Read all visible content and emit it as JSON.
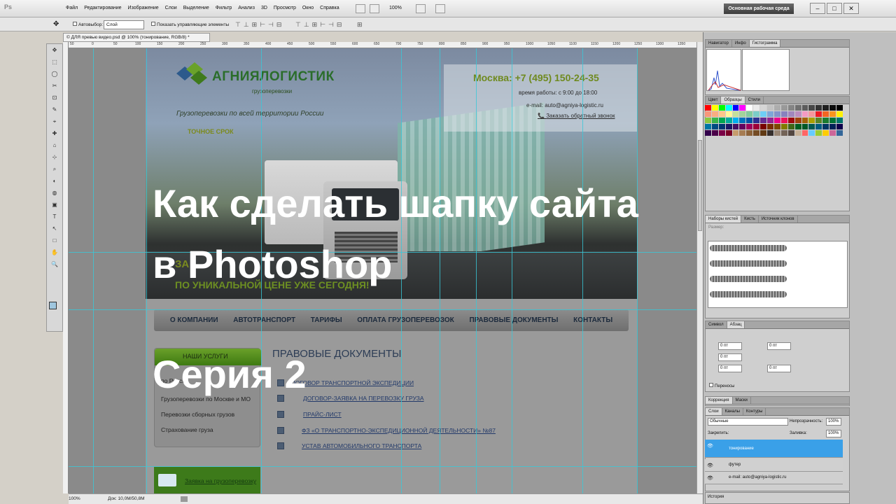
{
  "app": {
    "logo": "Ps",
    "workspace": "Основная рабочая среда",
    "zoom": "100%"
  },
  "menu": [
    "Файл",
    "Редактирование",
    "Изображение",
    "Слои",
    "Выделение",
    "Фильтр",
    "Анализ",
    "3D",
    "Просмотр",
    "Окно",
    "Справка"
  ],
  "options": {
    "autoselect": "Автовыбор:",
    "layer_value": "Слой",
    "show_controls": "Показать управляющие элементы"
  },
  "doc_tab": "© ДЛЯ превью видео.psd @ 100% (тонирование, RGB/8) *",
  "ruler_marks": [
    "50",
    "0",
    "50",
    "100",
    "150",
    "200",
    "250",
    "300",
    "350",
    "400",
    "450",
    "500",
    "550",
    "600",
    "650",
    "700",
    "750",
    "800",
    "850",
    "900",
    "950",
    "1000",
    "1050",
    "1100",
    "1150",
    "1200",
    "1250",
    "1300",
    "1350",
    "1400"
  ],
  "site": {
    "logo_text": "АГНИЯЛОГИСТИК",
    "logo_sub": "грузоперевозки",
    "tagline": "Грузоперевозки по всей территории России",
    "exact": "ТОЧНОЕ СРОК",
    "phone": "Москва: +7 (495) 150-24-35",
    "hours": "время работы: с 9:00 до 18:00",
    "email": "e-mail: auto@agniya-logistic.ru",
    "callback": "Заказать обратный звонок",
    "slogan1": "ЗА",
    "slogan2": "ПО УНИКАЛЬНОЙ ЦЕНЕ УЖЕ СЕГОДНЯ!",
    "nav": [
      "О КОМПАНИИ",
      "АВТОТРАНСПОРТ",
      "ТАРИФЫ",
      "ОПЛАТА ГРУЗОПЕРЕВОЗОК",
      "ПРАВОВЫЕ ДОКУМЕНТЫ",
      "КОНТАКТЫ"
    ],
    "services_title": "НАШИ УСЛУГИ",
    "services": [
      "по России",
      "Грузоперевозки по Москве и МО",
      "Перевозки сборных грузов",
      "Страхование груза"
    ],
    "docs_title": "ПРАВОВЫЕ ДОКУМЕНТЫ",
    "docs": [
      "ДОГОВОР ТРАНСПОРТНОЙ ЭКСПЕДИЦИИ",
      "ДОГОВОР-ЗАЯВКА НА ПЕРЕВОЗКУ ГРУЗА",
      "ПРАЙС-ЛИСТ",
      "ФЗ «О ТРАНСПОРТНО-ЭКСПЕДИЦИОННОЙ ДЕЯТЕЛЬНОСТИ» №87",
      "УСТАВ АВТОМОБИЛЬНОГО ТРАНСПОРТА"
    ],
    "app_link": "Заявка на грузоперевозку"
  },
  "overlay": {
    "line1": "Как сделать шапку сайта",
    "line2": "в Photoshop",
    "series": "Серия 2"
  },
  "status": {
    "zoom": "100%",
    "doc": "Док: 10,0M/50,8M"
  },
  "panels": {
    "nav_tabs": [
      "Навигатор",
      "Инфо",
      "Гистограмма"
    ],
    "color_tabs": [
      "Цвет",
      "Образцы",
      "Стили"
    ],
    "brush_tabs": [
      "Наборы кистей",
      "Кисть",
      "Источник клонов"
    ],
    "brush_size": "Размер:",
    "type_tabs": [
      "Символ",
      "Абзац"
    ],
    "para_values": [
      "0 пт",
      "0 пт",
      "0 пт",
      "0 пт",
      "0 пт"
    ],
    "hyphen": "Переносы",
    "adj_tabs": [
      "Коррекция",
      "Маски"
    ],
    "layer_tabs": [
      "Слои",
      "Каналы",
      "Контуры"
    ],
    "blend": "Обычные",
    "opacity_label": "Непрозрачность:",
    "opacity": "100%",
    "lock": "Закрепить:",
    "fill_label": "Заливка:",
    "fill": "100%",
    "layers": [
      "тонирование",
      "футер",
      "e-mail: auto@agniya-logistic.ru"
    ],
    "history": "История"
  },
  "swatch_colors": [
    "#ff0000",
    "#ffff00",
    "#00ff00",
    "#00ffff",
    "#0000ff",
    "#ff00ff",
    "#ffffff",
    "#ebebeb",
    "#d6d6d6",
    "#c2c2c2",
    "#adadad",
    "#999999",
    "#858585",
    "#707070",
    "#5c5c5c",
    "#474747",
    "#333333",
    "#1f1f1f",
    "#0a0a0a",
    "#000000",
    "#f7977a",
    "#f9ad81",
    "#fdc68a",
    "#fff79a",
    "#c4df9b",
    "#a2d39c",
    "#82ca9d",
    "#7bcdc8",
    "#6ecff6",
    "#7ea7d8",
    "#8493ca",
    "#8882be",
    "#a187be",
    "#bc8dbf",
    "#f49ac2",
    "#f6989d",
    "#ed1c24",
    "#f26522",
    "#f7941d",
    "#fff200",
    "#8dc73f",
    "#39b54a",
    "#00a651",
    "#00a99d",
    "#00aeef",
    "#0072bc",
    "#0054a6",
    "#2e3192",
    "#662d91",
    "#92278f",
    "#ec008c",
    "#ed145b",
    "#9e0b0f",
    "#a0410d",
    "#a36209",
    "#aba000",
    "#598527",
    "#1a7b30",
    "#007236",
    "#00746b",
    "#0076a3",
    "#004b80",
    "#003471",
    "#1b1464",
    "#440e62",
    "#630460",
    "#9e005d",
    "#9e0039",
    "#790000",
    "#7b2e00",
    "#7d4900",
    "#827b00",
    "#406618",
    "#005e20",
    "#005826",
    "#005952",
    "#005b7f",
    "#003663",
    "#002157",
    "#0d004c",
    "#32004b",
    "#4b0049",
    "#7b0046",
    "#7a0026",
    "#c69c6d",
    "#a67c52",
    "#8c6239",
    "#754c24",
    "#603913",
    "#362f2d",
    "#998675",
    "#736357",
    "#534741",
    "#c7b299",
    "#ff6666",
    "#66ccff",
    "#99cc33",
    "#ffcc00",
    "#cc6699",
    "#336699"
  ]
}
